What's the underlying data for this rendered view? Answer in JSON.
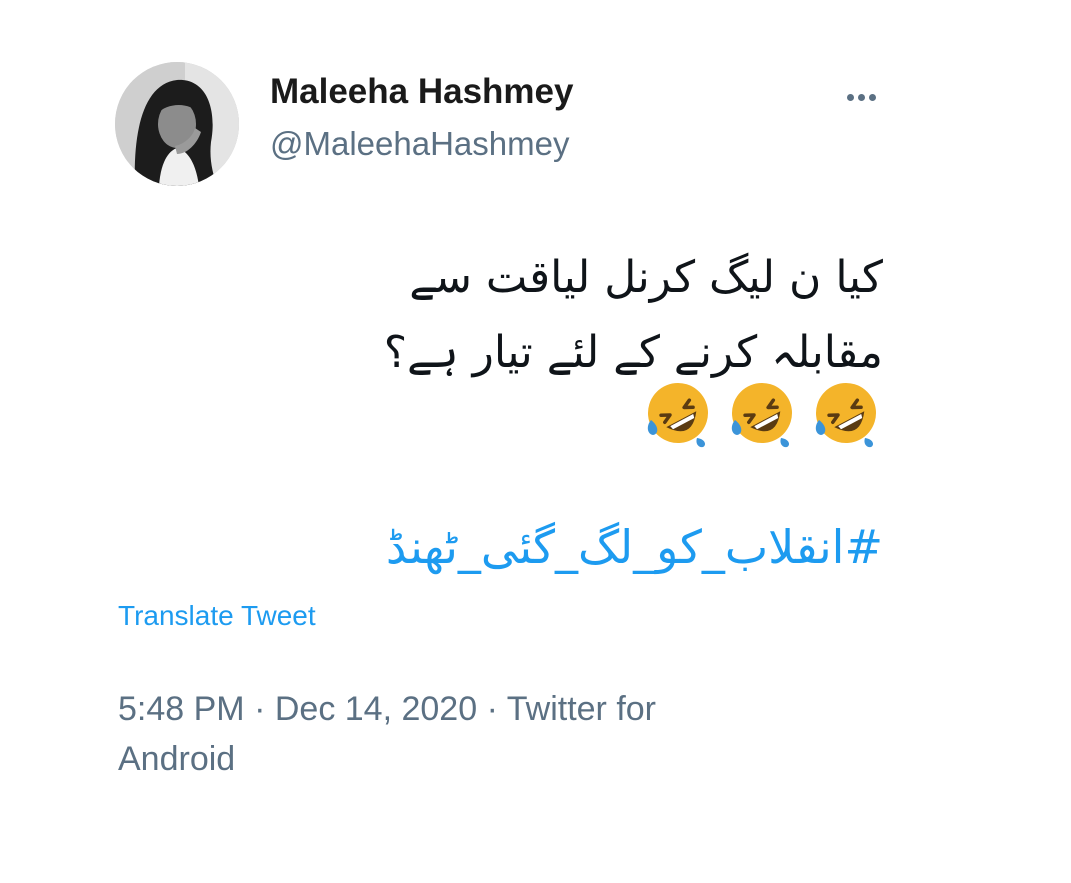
{
  "author": {
    "display_name": "Maleeha Hashmey",
    "handle": "@MaleehaHashmey"
  },
  "tweet": {
    "text_lines": [
      "کیا ن لیگ کرنل لیاقت سے",
      "مقابلہ کرنے کے لئے تیار ہے؟"
    ],
    "emojis": [
      "rolling-on-floor-laughing-emoji",
      "rolling-on-floor-laughing-emoji",
      "rolling-on-floor-laughing-emoji"
    ],
    "hashtag": "#انقلاب_کو_لگ_گئی_ٹھنڈ",
    "translate_label": "Translate Tweet"
  },
  "meta": {
    "time": "5:48 PM",
    "separator": "·",
    "date": "Dec 14, 2020",
    "source_part1": "Twitter for",
    "source_part2": "Android"
  },
  "icons": {
    "more": "more-dots-icon"
  },
  "colors": {
    "link": "#1d9bf0",
    "secondary_text": "#5b7083",
    "primary_text": "#0f1419"
  }
}
